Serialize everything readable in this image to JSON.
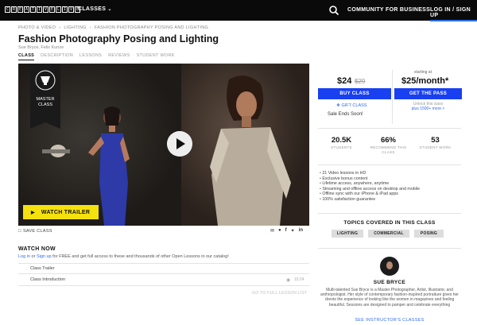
{
  "nav": {
    "logo_letters": [
      "C",
      "R",
      "E",
      "A",
      "T",
      "I",
      "V",
      "E",
      "L",
      "I",
      "V",
      "E"
    ],
    "classes": "CLASSES",
    "community": "COMMUNITY",
    "business": "FOR BUSINESS",
    "login": "LOG IN / SIGN UP"
  },
  "breadcrumb": [
    "PHOTO & VIDEO",
    "LIGHTING",
    "FASHION PHOTOGRAPHY POSING AND LIGHTING"
  ],
  "course": {
    "title": "Fashion Photography Posing and Lighting",
    "instructors": "Sue Bryce, Felix Kunze"
  },
  "tabs": [
    "CLASS",
    "DESCRIPTION",
    "LESSONS",
    "REVIEWS",
    "STUDENT WORK"
  ],
  "video": {
    "badge": "MASTER CLASS",
    "trailer_label": "WATCH TRAILER"
  },
  "actions": {
    "save": "SAVE CLASS",
    "share_icons": [
      "email-icon",
      "pinterest-icon",
      "facebook-icon",
      "twitter-icon",
      "link-icon"
    ]
  },
  "watch": {
    "title": "WATCH NOW",
    "link_login": "Log in",
    "or": " or ",
    "link_signup": "Sign up",
    "rest": " for FREE and get full access to these and thousands of other Open Lessons in our catalog!",
    "lessons": [
      {
        "title": "Class Trailer",
        "time": ""
      },
      {
        "title": "Class Introduction",
        "time": "15:24"
      }
    ],
    "full_list": "GO TO FULL LESSON LIST"
  },
  "purchase": {
    "price": "$24",
    "old_price": "$29",
    "buy": "BUY CLASS",
    "gift": "GIFT CLASS",
    "ends": "Sale Ends Soon!",
    "starting": "starting at",
    "monthly": "$25/month*",
    "pass": "GET THE PASS",
    "unlock": "Unlock this class",
    "unlock_link": "plus 1500+ more >"
  },
  "stats": [
    {
      "num": "20.5K",
      "label": "STUDENTS"
    },
    {
      "num": "66%",
      "label": "RECOMMEND THIS CLASS"
    },
    {
      "num": "53",
      "label": "STUDENT WORK"
    }
  ],
  "features": [
    "21 Video lessons in HD",
    "Exclusive bonus content",
    "Lifetime access, anywhere, anytime",
    "Streaming and offline access on desktop and mobile",
    "Offline sync with our iPhone & iPad apps",
    "100% satisfaction guarantee"
  ],
  "topics": {
    "title": "TOPICS COVERED IN THIS CLASS",
    "items": [
      "LIGHTING",
      "COMMERCIAL",
      "POSING"
    ]
  },
  "instructor": {
    "name": "SUE BRYCE",
    "bio": "Multi-talented Sue Bryce is a Master Photographer, Artist, Illustrator, and anthropologist. Her style of contemporary fashion-inspired portraiture gives her clients the experience of looking like the women in magazines and feeling beautiful. Sessions are designed to pamper and celebrate everything",
    "see_classes": "SEE INSTRUCTOR'S CLASSES"
  },
  "colors": {
    "accent": "#1940f0",
    "link": "#2f6cf0",
    "trailer": "#f5e10d",
    "nav_bg": "#0a0a0a"
  }
}
